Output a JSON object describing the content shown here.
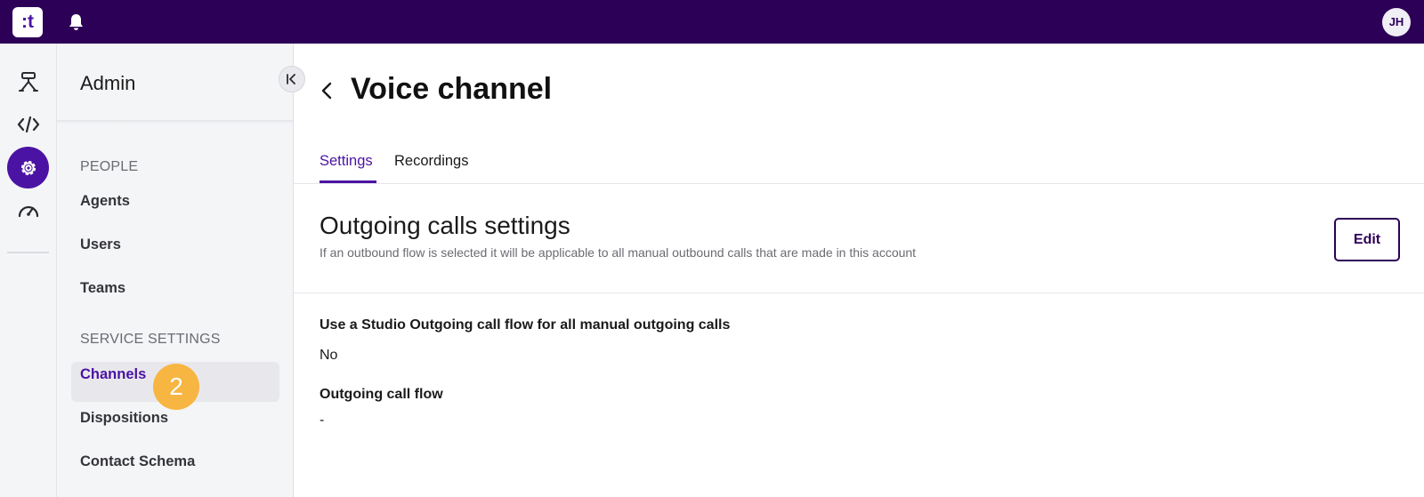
{
  "topbar": {
    "logo_text": ":t",
    "avatar_initials": "JH"
  },
  "rail": {
    "icons": [
      "flow-icon",
      "code-icon",
      "gear-icon",
      "gauge-icon"
    ]
  },
  "sidebar": {
    "title": "Admin",
    "sections": [
      {
        "label": "PEOPLE",
        "items": [
          "Agents",
          "Users",
          "Teams"
        ]
      },
      {
        "label": "SERVICE SETTINGS",
        "items": [
          "Channels",
          "Dispositions",
          "Contact Schema"
        ]
      }
    ],
    "active_item": "Channels",
    "step_badge": "2"
  },
  "main": {
    "title": "Voice channel",
    "tabs": [
      {
        "label": "Settings",
        "active": true
      },
      {
        "label": "Recordings",
        "active": false
      }
    ],
    "section": {
      "title": "Outgoing calls settings",
      "description": "If an outbound flow is selected it will be applicable to all manual outbound calls that are made in this account",
      "edit_label": "Edit"
    },
    "fields": [
      {
        "label": "Use a Studio Outgoing call flow for all manual outgoing calls",
        "value": "No"
      },
      {
        "label": "Outgoing call flow",
        "value": "-"
      }
    ]
  },
  "colors": {
    "brand": "#2d0058",
    "accent": "#4b13a3",
    "badge": "#f7b541"
  }
}
